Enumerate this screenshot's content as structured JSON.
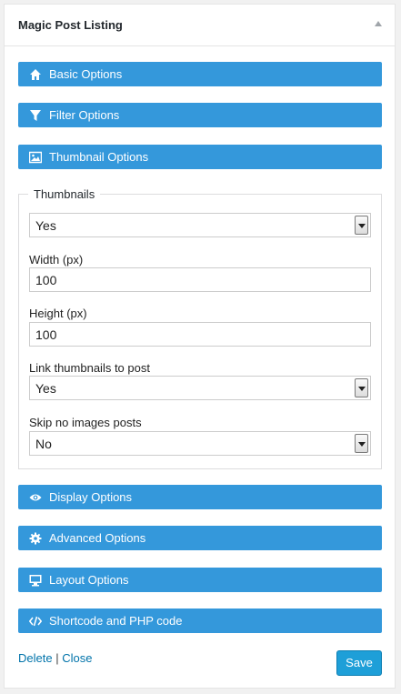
{
  "widget": {
    "title": "Magic Post Listing"
  },
  "sections": {
    "basic": "Basic Options",
    "filter": "Filter Options",
    "thumbnail": "Thumbnail Options",
    "display": "Display Options",
    "advanced": "Advanced Options",
    "layout": "Layout Options",
    "shortcode": "Shortcode and PHP code"
  },
  "thumbnails": {
    "legend": "Thumbnails",
    "enabled": "Yes",
    "width_label": "Width (px)",
    "width_value": "100",
    "height_label": "Height (px)",
    "height_value": "100",
    "link_label": "Link thumbnails to post",
    "link_value": "Yes",
    "skip_label": "Skip no images posts",
    "skip_value": "No"
  },
  "footer": {
    "delete": "Delete",
    "separator": "|",
    "close": "Close",
    "save": "Save"
  },
  "colors": {
    "section_bg": "#3498db",
    "save_bg": "#1e9fd8",
    "link": "#0073aa"
  },
  "icons": {
    "basic": "home-icon",
    "filter": "funnel-icon",
    "thumbnail": "image-icon",
    "display": "eye-icon",
    "advanced": "gear-icon",
    "layout": "monitor-icon",
    "shortcode": "code-icon"
  }
}
